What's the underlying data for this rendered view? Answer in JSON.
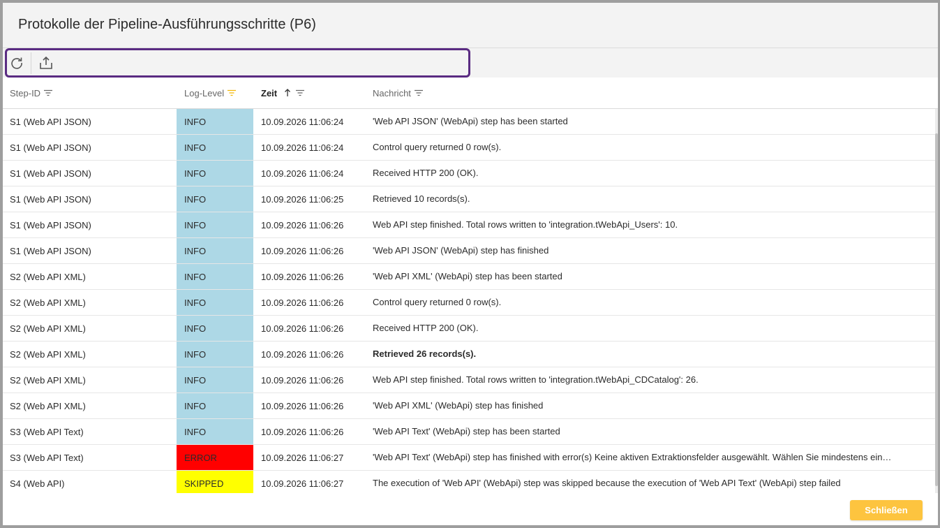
{
  "dialog": {
    "title": "Protokolle der Pipeline-Ausführungsschritte (P6)"
  },
  "toolbar": {
    "refresh_icon": "refresh-icon",
    "export_icon": "export-icon"
  },
  "columns": {
    "step": "Step-ID",
    "level": "Log-Level",
    "time": "Zeit",
    "message": "Nachricht"
  },
  "level_colors": {
    "INFO": "#add8e6",
    "ERROR": "#ff0000",
    "SKIPPED": "#ffff00"
  },
  "rows": [
    {
      "step": "S1 (Web API JSON)",
      "level": "INFO",
      "time": "10.09.2026 11:06:24",
      "message": "'Web API JSON' (WebApi) step has been started"
    },
    {
      "step": "S1 (Web API JSON)",
      "level": "INFO",
      "time": "10.09.2026 11:06:24",
      "message": "Control query returned 0 row(s)."
    },
    {
      "step": "S1 (Web API JSON)",
      "level": "INFO",
      "time": "10.09.2026 11:06:24",
      "message": "Received HTTP 200 (OK)."
    },
    {
      "step": "S1 (Web API JSON)",
      "level": "INFO",
      "time": "10.09.2026 11:06:25",
      "message": "Retrieved 10 records(s)."
    },
    {
      "step": "S1 (Web API JSON)",
      "level": "INFO",
      "time": "10.09.2026 11:06:26",
      "message": "Web API step finished. Total rows written to 'integration.tWebApi_Users': 10."
    },
    {
      "step": "S1 (Web API JSON)",
      "level": "INFO",
      "time": "10.09.2026 11:06:26",
      "message": "'Web API JSON' (WebApi) step has finished"
    },
    {
      "step": "S2 (Web API XML)",
      "level": "INFO",
      "time": "10.09.2026 11:06:26",
      "message": "'Web API XML' (WebApi) step has been started"
    },
    {
      "step": "S2 (Web API XML)",
      "level": "INFO",
      "time": "10.09.2026 11:06:26",
      "message": "Control query returned 0 row(s)."
    },
    {
      "step": "S2 (Web API XML)",
      "level": "INFO",
      "time": "10.09.2026 11:06:26",
      "message": "Received HTTP 200 (OK)."
    },
    {
      "step": "S2 (Web API XML)",
      "level": "INFO",
      "time": "10.09.2026 11:06:26",
      "message": "Retrieved 26 records(s).",
      "bold": true
    },
    {
      "step": "S2 (Web API XML)",
      "level": "INFO",
      "time": "10.09.2026 11:06:26",
      "message": "Web API step finished. Total rows written to 'integration.tWebApi_CDCatalog': 26."
    },
    {
      "step": "S2 (Web API XML)",
      "level": "INFO",
      "time": "10.09.2026 11:06:26",
      "message": "'Web API XML' (WebApi) step has finished"
    },
    {
      "step": "S3 (Web API Text)",
      "level": "INFO",
      "time": "10.09.2026 11:06:26",
      "message": "'Web API Text' (WebApi) step has been started"
    },
    {
      "step": "S3 (Web API Text)",
      "level": "ERROR",
      "time": "10.09.2026 11:06:27",
      "message": "'Web API Text' (WebApi) step has finished with error(s) Keine aktiven Extraktionsfelder ausgewählt. Wählen Sie mindestens ein…"
    },
    {
      "step": "S4 (Web API)",
      "level": "SKIPPED",
      "time": "10.09.2026 11:06:27",
      "message": "The execution of 'Web API' (WebApi) step was skipped because the execution of 'Web API Text' (WebApi) step failed"
    }
  ],
  "footer": {
    "close_label": "Schließen"
  },
  "accent": "#fdc43f",
  "focus_border": "#5a2b82"
}
